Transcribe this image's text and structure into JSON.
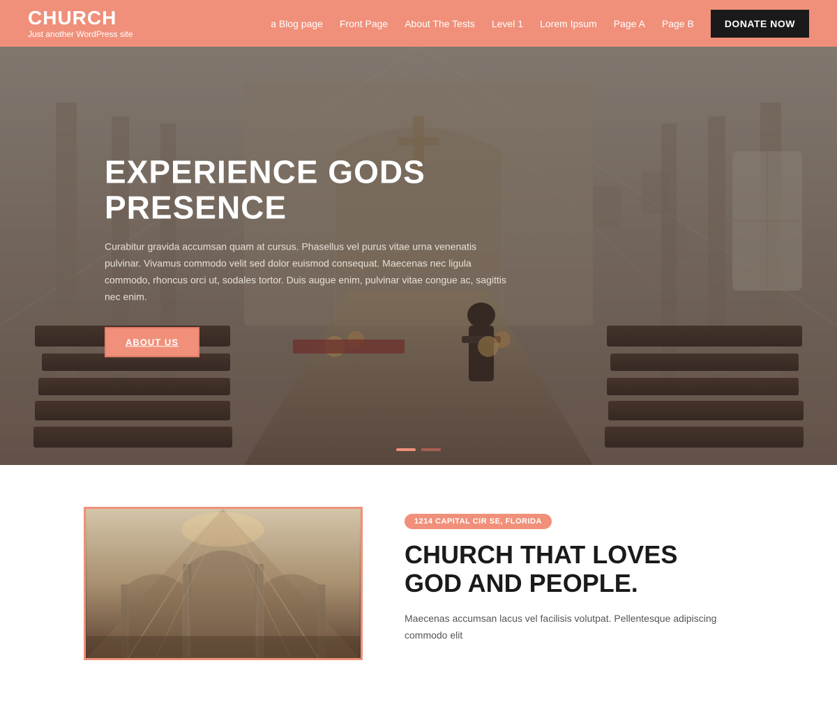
{
  "header": {
    "logo_title": "CHURCH",
    "logo_subtitle": "Just another WordPress site",
    "nav_items": [
      {
        "label": "a Blog page",
        "href": "#"
      },
      {
        "label": "Front Page",
        "href": "#"
      },
      {
        "label": "About The Tests",
        "href": "#"
      },
      {
        "label": "Level 1",
        "href": "#"
      },
      {
        "label": "Lorem Ipsum",
        "href": "#"
      },
      {
        "label": "Page A",
        "href": "#"
      },
      {
        "label": "Page B",
        "href": "#"
      }
    ],
    "donate_label": "DONATE NOW"
  },
  "hero": {
    "title": "EXPERIENCE GODS PRESENCE",
    "description": "Curabitur gravida accumsan quam at cursus. Phasellus vel purus vitae urna venenatis pulvinar. Vivamus commodo velit sed dolor euismod consequat. Maecenas nec ligula commodo, rhoncus orci ut, sodales tortor. Duis augue enim, pulvinar vitae congue ac, sagittis nec enim.",
    "cta_label": "ABOUT US"
  },
  "section_two": {
    "location_badge": "1214 CAPITAL CIR SE, FLORIDA",
    "heading_line1": "CHURCH THAT LOVES",
    "heading_line2": "GOD AND PEOPLE.",
    "description": "Maecenas accumsan lacus vel facilisis volutpat. Pellentesque adipiscing commodo elit"
  },
  "colors": {
    "salmon": "#f0907a",
    "dark": "#1a1a1a",
    "white": "#ffffff"
  }
}
